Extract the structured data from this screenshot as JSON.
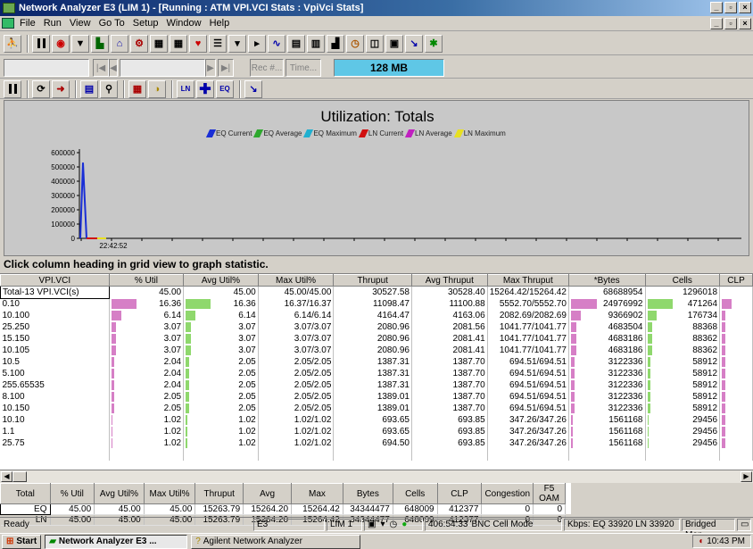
{
  "window": {
    "title": "Network Analyzer E3 (LIM 1) - [Running : ATM VPI.VCI Stats : VpiVci Stats]"
  },
  "menu": [
    "File",
    "Run",
    "View",
    "Go To",
    "Setup",
    "Window",
    "Help"
  ],
  "toolbar2": {
    "rec_label": "Rec #...",
    "time_label": "Time...",
    "memory": "128 MB"
  },
  "toolbar3": {
    "ln_label": "LN",
    "eq_label": "EQ"
  },
  "chart_data": {
    "type": "line",
    "title": "Utilization: Totals",
    "legend": [
      "EQ Current",
      "EQ Average",
      "EQ Maximum",
      "LN Current",
      "LN Average",
      "LN Maximum"
    ],
    "legend_colors": [
      "#1a2fd6",
      "#2ea82e",
      "#20b0d0",
      "#d01010",
      "#c020c0",
      "#e8e020"
    ],
    "yticks": [
      "600000",
      "500000",
      "400000",
      "300000",
      "200000",
      "100000",
      "0"
    ],
    "ylim": [
      0,
      600000
    ],
    "xtick": "22:42:52",
    "series": [
      {
        "name": "EQ Current",
        "values": [
          0,
          530000,
          0
        ]
      },
      {
        "name": "LN Current",
        "values": [
          0,
          0,
          0
        ]
      }
    ]
  },
  "hint": "Click column heading in grid view to graph statistic.",
  "grid": {
    "headers": [
      "VPI.VCI",
      "% Util",
      "Avg Util%",
      "Max Util%",
      "Thruput",
      "Avg Thruput",
      "Max Thruput",
      "*Bytes",
      "Cells",
      "CLP"
    ],
    "rows": [
      {
        "id": "Total-13 VPI.VCI(s)",
        "util": "45.00",
        "avg": "45.00",
        "max": "45.00/45.00",
        "thru": "30527.58",
        "avgthru": "30528.40",
        "maxthru": "15264.42/15264.42",
        "bytes": "68688954",
        "cells": "1296018",
        "u": 0,
        "b": 0,
        "c": 0
      },
      {
        "id": "0.10",
        "util": "16.36",
        "avg": "16.36",
        "max": "16.37/16.37",
        "thru": "11098.47",
        "avgthru": "11100.88",
        "maxthru": "5552.70/5552.70",
        "bytes": "24976992",
        "cells": "471264",
        "u": 0.36,
        "b": 0.36,
        "c": 0.36
      },
      {
        "id": "10.100",
        "util": "6.14",
        "avg": "6.14",
        "max": "6.14/6.14",
        "thru": "4164.47",
        "avgthru": "4163.06",
        "maxthru": "2082.69/2082.69",
        "bytes": "9366902",
        "cells": "176734",
        "u": 0.14,
        "b": 0.14,
        "c": 0.14
      },
      {
        "id": "25.250",
        "util": "3.07",
        "avg": "3.07",
        "max": "3.07/3.07",
        "thru": "2080.96",
        "avgthru": "2081.56",
        "maxthru": "1041.77/1041.77",
        "bytes": "4683504",
        "cells": "88368",
        "u": 0.07,
        "b": 0.07,
        "c": 0.07
      },
      {
        "id": "15.150",
        "util": "3.07",
        "avg": "3.07",
        "max": "3.07/3.07",
        "thru": "2080.96",
        "avgthru": "2081.41",
        "maxthru": "1041.77/1041.77",
        "bytes": "4683186",
        "cells": "88362",
        "u": 0.07,
        "b": 0.07,
        "c": 0.07
      },
      {
        "id": "10.105",
        "util": "3.07",
        "avg": "3.07",
        "max": "3.07/3.07",
        "thru": "2080.96",
        "avgthru": "2081.41",
        "maxthru": "1041.77/1041.77",
        "bytes": "4683186",
        "cells": "88362",
        "u": 0.07,
        "b": 0.07,
        "c": 0.07
      },
      {
        "id": "10.5",
        "util": "2.04",
        "avg": "2.05",
        "max": "2.05/2.05",
        "thru": "1387.31",
        "avgthru": "1387.70",
        "maxthru": "694.51/694.51",
        "bytes": "3122336",
        "cells": "58912",
        "u": 0.045,
        "b": 0.045,
        "c": 0.045
      },
      {
        "id": "5.100",
        "util": "2.04",
        "avg": "2.05",
        "max": "2.05/2.05",
        "thru": "1387.31",
        "avgthru": "1387.70",
        "maxthru": "694.51/694.51",
        "bytes": "3122336",
        "cells": "58912",
        "u": 0.045,
        "b": 0.045,
        "c": 0.045
      },
      {
        "id": "255.65535",
        "util": "2.04",
        "avg": "2.05",
        "max": "2.05/2.05",
        "thru": "1387.31",
        "avgthru": "1387.70",
        "maxthru": "694.51/694.51",
        "bytes": "3122336",
        "cells": "58912",
        "u": 0.045,
        "b": 0.045,
        "c": 0.045
      },
      {
        "id": "8.100",
        "util": "2.05",
        "avg": "2.05",
        "max": "2.05/2.05",
        "thru": "1389.01",
        "avgthru": "1387.70",
        "maxthru": "694.51/694.51",
        "bytes": "3122336",
        "cells": "58912",
        "u": 0.045,
        "b": 0.045,
        "c": 0.045
      },
      {
        "id": "10.150",
        "util": "2.05",
        "avg": "2.05",
        "max": "2.05/2.05",
        "thru": "1389.01",
        "avgthru": "1387.70",
        "maxthru": "694.51/694.51",
        "bytes": "3122336",
        "cells": "58912",
        "u": 0.045,
        "b": 0.045,
        "c": 0.045
      },
      {
        "id": "10.10",
        "util": "1.02",
        "avg": "1.02",
        "max": "1.02/1.02",
        "thru": "693.65",
        "avgthru": "693.85",
        "maxthru": "347.26/347.26",
        "bytes": "1561168",
        "cells": "29456",
        "u": 0.02,
        "b": 0.02,
        "c": 0.02
      },
      {
        "id": "1.1",
        "util": "1.02",
        "avg": "1.02",
        "max": "1.02/1.02",
        "thru": "693.65",
        "avgthru": "693.85",
        "maxthru": "347.26/347.26",
        "bytes": "1561168",
        "cells": "29456",
        "u": 0.02,
        "b": 0.02,
        "c": 0.02
      },
      {
        "id": "25.75",
        "util": "1.02",
        "avg": "1.02",
        "max": "1.02/1.02",
        "thru": "694.50",
        "avgthru": "693.85",
        "maxthru": "347.26/347.26",
        "bytes": "1561168",
        "cells": "29456",
        "u": 0.02,
        "b": 0.02,
        "c": 0.02
      }
    ]
  },
  "totals": {
    "headers": [
      "Total",
      "% Util",
      "Avg Util%",
      "Max Util%",
      "Thruput",
      "Avg",
      "Max",
      "Bytes",
      "Cells",
      "CLP",
      "Congestion",
      "F5 OAM"
    ],
    "rows": [
      [
        "EQ",
        "45.00",
        "45.00",
        "45.00",
        "15263.79",
        "15264.20",
        "15264.42",
        "34344477",
        "648009",
        "412377",
        "0",
        "0"
      ],
      [
        "LN",
        "45.00",
        "45.00",
        "45.00",
        "15263.79",
        "15264.20",
        "15264.42",
        "34344477",
        "648009",
        "412377",
        "0",
        "0"
      ]
    ]
  },
  "status": {
    "ready": "Ready",
    "e3": "E3",
    "lim": "LIM 1",
    "time": "406:54:33",
    "mode": "BNC Cell Mode",
    "kbps": "Kbps: EQ 33920 LN 33920",
    "bridged": "Bridged Mon"
  },
  "taskbar": {
    "start": "Start",
    "task1": "Network Analyzer E3 ...",
    "task2": "Agilent Network Analyzer",
    "clock": "10:43 PM"
  }
}
